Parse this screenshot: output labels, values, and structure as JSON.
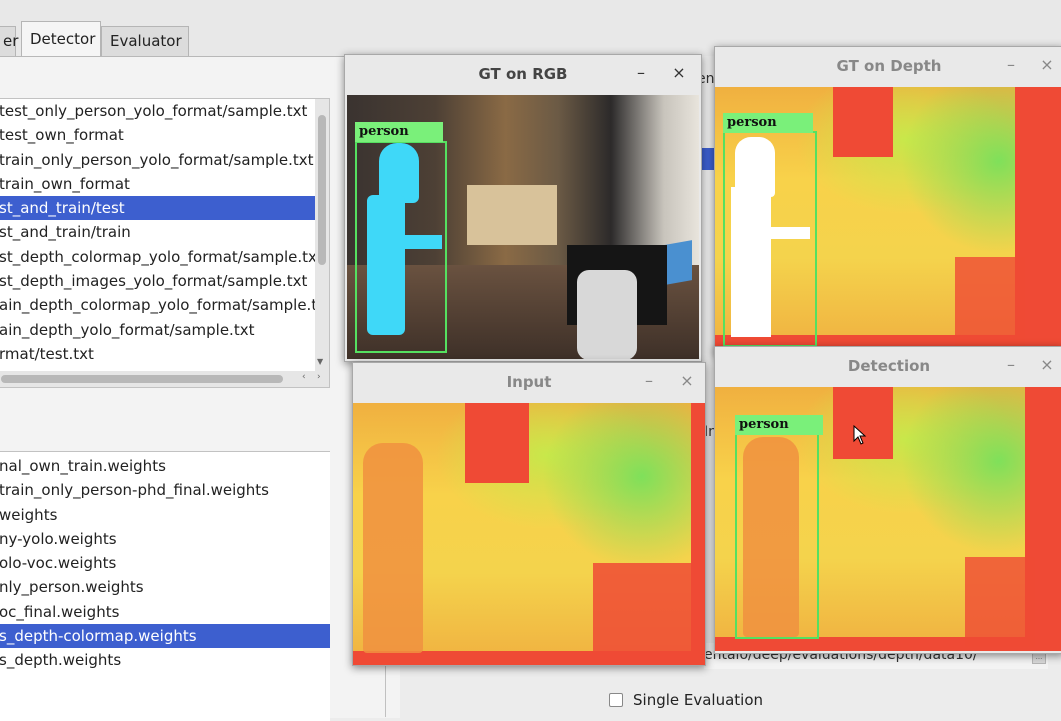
{
  "tabs": [
    {
      "label": "er",
      "active": false
    },
    {
      "label": "Detector",
      "active": true
    },
    {
      "label": "Evaluator",
      "active": false
    }
  ],
  "dataset_list": [
    "test_only_person_yolo_format/sample.txt",
    "test_own_format",
    "train_only_person_yolo_format/sample.txt",
    "train_own_format",
    "st_and_train/test",
    "st_and_train/train",
    "st_depth_colormap_yolo_format/sample.tx",
    "st_depth_images_yolo_format/sample.txt",
    "ain_depth_colormap_yolo_format/sample.t:",
    "ain_depth_yolo_format/sample.txt",
    "rmat/test.txt"
  ],
  "dataset_selected_index": 4,
  "weights_list": [
    "nal_own_train.weights",
    "train_only_person-phd_final.weights",
    "weights",
    "ny-yolo.weights",
    "olo-voc.weights",
    "nly_person.weights",
    "oc_final.weights",
    "s_depth-colormap.weights",
    "s_depth.weights"
  ],
  "weights_selected_index": 7,
  "windows": {
    "gt_rgb": {
      "title": "GT on RGB",
      "label": "person"
    },
    "gt_depth": {
      "title": "GT on Depth",
      "label": "person"
    },
    "input": {
      "title": "Input"
    },
    "detection": {
      "title": "Detection",
      "label": "person"
    }
  },
  "buttons": {
    "minimize": "–",
    "close": "×"
  },
  "path_field": {
    "value": "entalo/deep/evaluations/depth/data10/"
  },
  "single_evaluation": {
    "label": "Single Evaluation",
    "checked": false
  },
  "partial_labels": {
    "en": "en",
    "in": "In"
  },
  "colors": {
    "selection": "#3d5fcf",
    "bbox": "#55e060",
    "depth_red": "#ef4a35"
  }
}
